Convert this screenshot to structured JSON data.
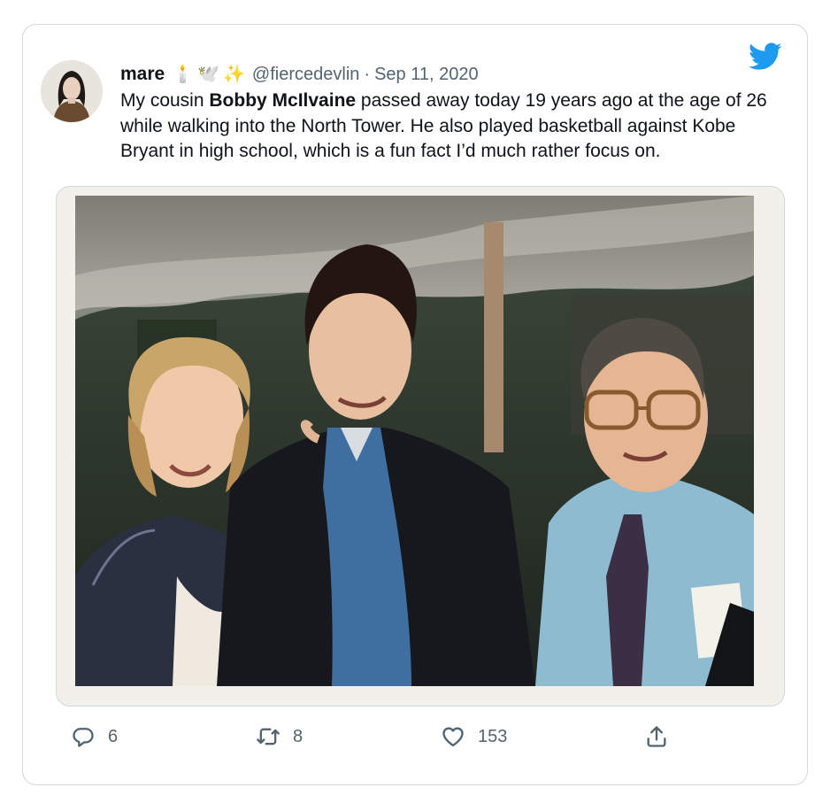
{
  "tweet": {
    "author": {
      "display_name": "mare",
      "emoji": [
        "🕯️",
        "🕊️",
        "✨"
      ],
      "handle": "@fiercedevlin"
    },
    "separator": "·",
    "date": "Sep 11, 2020",
    "text": {
      "before": "My cousin ",
      "bold": "Bobby McIlvaine",
      "after": " passed away today 19 years ago at the age of 26 while walking into the North Tower. He also played basketball against Kobe Bryant in high school, which is a fun fact I’d much rather focus on."
    },
    "counts": {
      "replies": "6",
      "retweets": "8",
      "likes": "153"
    }
  },
  "icons": {
    "brand": "twitter-bird-icon",
    "reply": "reply-icon",
    "retweet": "retweet-icon",
    "like": "heart-icon",
    "share": "share-icon"
  },
  "colors": {
    "brand": "#1d9bf0",
    "secondary_text": "#536471",
    "border": "#cfd9de"
  }
}
